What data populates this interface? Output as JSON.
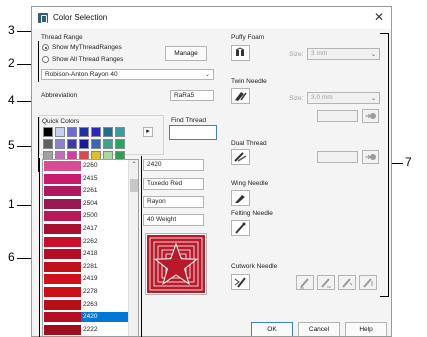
{
  "dialog": {
    "title": "Color Selection",
    "close_glyph": "✕"
  },
  "thread_range": {
    "label": "Thread Range",
    "option_my": "Show MyThreadRanges",
    "option_all": "Show All Thread Ranges",
    "selected": "my",
    "manage_label": "Manage",
    "combo_value": "Robison-Anton Rayon 40",
    "chevron": "⌄"
  },
  "abbreviation": {
    "label": "Abbreviation",
    "value": "RaRa5"
  },
  "quick_colors": {
    "label": "Quick Colors",
    "arrow": "▸",
    "rows": [
      [
        "#000000",
        "#c8d0f0",
        "#6a6ad8",
        "#1f2fa8",
        "#2828c0",
        "#1e6f8e",
        "#2f9fa0"
      ],
      [
        "#606060",
        "#8a80d0",
        "#3c3ca8",
        "#1818a0",
        "#3868b0",
        "#40a090",
        "#20a860"
      ],
      [
        "#a0a0a0",
        "#c070b8",
        "#d040a0",
        "#e04850",
        "#e0c020",
        "#a8d8a0",
        "#30a050"
      ],
      [
        "#d8d8d8",
        "#e8b0c8",
        "#d01020",
        "#e87030",
        "#f0e060",
        "#d8f0a0",
        "#b0e080"
      ]
    ]
  },
  "find_thread": {
    "label": "Find Thread",
    "value": ""
  },
  "thread_list": {
    "scroll_up": "⌃",
    "selected_code": "2420",
    "items": [
      {
        "code": "2260",
        "color": "#d84d92"
      },
      {
        "code": "2415",
        "color": "#c81a6c"
      },
      {
        "code": "2261",
        "color": "#b01860"
      },
      {
        "code": "2504",
        "color": "#9a1850"
      },
      {
        "code": "2500",
        "color": "#b81858"
      },
      {
        "code": "2417",
        "color": "#a81030"
      },
      {
        "code": "2262",
        "color": "#c8102c"
      },
      {
        "code": "2418",
        "color": "#b20e28"
      },
      {
        "code": "2281",
        "color": "#c0101c"
      },
      {
        "code": "2419",
        "color": "#d0101c"
      },
      {
        "code": "2278",
        "color": "#cc1018"
      },
      {
        "code": "2263",
        "color": "#b80e18"
      },
      {
        "code": "2420",
        "color": "#b50e22"
      },
      {
        "code": "2222",
        "color": "#a00e1c"
      }
    ]
  },
  "details": {
    "code": "2420",
    "name": "Tuxedo Red",
    "material": "Rayon",
    "weight": "40 Weight"
  },
  "preview": {
    "fill": "#b81a2a",
    "line": "#ffffff"
  },
  "puffy_foam": {
    "title": "Puffy Foam",
    "size_label": "Size:",
    "size_value": "3 mm",
    "chevron": "⌄"
  },
  "twin_needle": {
    "title": "Twin Needle",
    "size_label": "Size:",
    "size_value": "3.0 mm",
    "chevron": "⌄"
  },
  "dual_thread": {
    "title": "Dual Thread"
  },
  "wing_needle": {
    "title": "Wing Needle"
  },
  "felting_needle": {
    "title": "Felting Needle"
  },
  "cutwork_needle": {
    "title": "Cutwork Needle"
  },
  "buttons": {
    "ok": "OK",
    "cancel": "Cancel",
    "help": "Help"
  },
  "callouts": [
    "1",
    "2",
    "3",
    "4",
    "5",
    "6",
    "7"
  ],
  "colors": {
    "selection": "#0078d7",
    "accent_blue": "#3a7fd0"
  }
}
